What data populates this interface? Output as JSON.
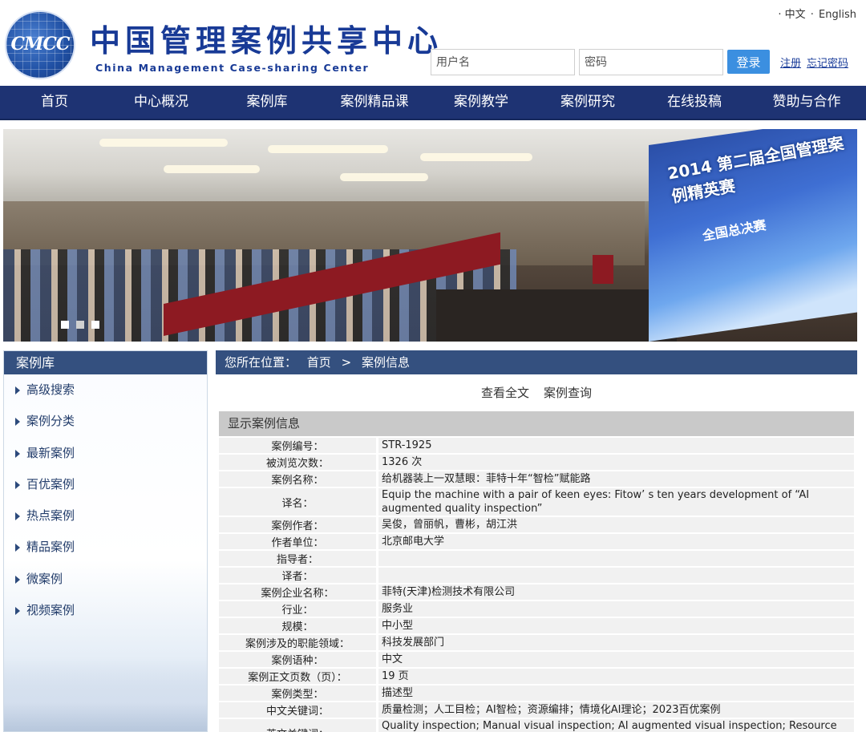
{
  "header": {
    "logo_abbr": "CMCC",
    "logo_cn": "中国管理案例共享中心",
    "logo_en": "China Management Case-sharing Center",
    "lang": {
      "cn": "· 中文",
      "sep": "·",
      "en": "English"
    },
    "login": {
      "username_placeholder": "用户名",
      "password_placeholder": "密码",
      "login_label": "登录",
      "register_label": "注册",
      "forgot_label": "忘记密码"
    }
  },
  "nav": {
    "items": [
      "首页",
      "中心概况",
      "案例库",
      "案例精品课",
      "案例教学",
      "案例研究",
      "在线投稿",
      "赞助与合作"
    ]
  },
  "banner": {
    "screen_title": "2014 第二届全国管理案例精英赛",
    "screen_sub": "全国总决赛",
    "slide_count": 3,
    "active_slide": 2
  },
  "sidebar": {
    "title": "案例库",
    "items": [
      "高级搜索",
      "案例分类",
      "最新案例",
      "百优案例",
      "热点案例",
      "精品案例",
      "微案例",
      "视频案例"
    ]
  },
  "main": {
    "breadcrumb": {
      "label": "您所在位置：",
      "home": "首页",
      "sep": ">",
      "current": "案例信息"
    },
    "tabs": [
      "查看全文",
      "案例查询"
    ],
    "panel_title": "显示案例信息",
    "rows": [
      {
        "k": "案例编号：",
        "v": "STR-1925"
      },
      {
        "k": "被浏览次数：",
        "v": "1326 次"
      },
      {
        "k": "案例名称：",
        "v": "给机器装上一双慧眼：菲特十年“智检”赋能路"
      },
      {
        "k": "译名：",
        "v": "Equip the machine with a pair of keen eyes: Fitow’ s ten years development of “AI augmented quality inspection”"
      },
      {
        "k": "案例作者：",
        "v": "吴俊，曾丽帆，曹彬，胡江洪"
      },
      {
        "k": "作者单位：",
        "v": "北京邮电大学"
      },
      {
        "k": "指导者：",
        "v": ""
      },
      {
        "k": "译者：",
        "v": ""
      },
      {
        "k": "案例企业名称：",
        "v": "菲特(天津)检测技术有限公司"
      },
      {
        "k": "行业：",
        "v": "服务业"
      },
      {
        "k": "规模：",
        "v": "中小型"
      },
      {
        "k": "案例涉及的职能领域：",
        "v": "科技发展部门"
      },
      {
        "k": "案例语种：",
        "v": "中文"
      },
      {
        "k": "案例正文页数（页）：",
        "v": "19 页"
      },
      {
        "k": "案例类型：",
        "v": "描述型"
      },
      {
        "k": "中文关键词：",
        "v": "质量检测；人工目检；AI智检；资源编排；情境化AI理论；2023百优案例"
      },
      {
        "k": "英文关键词：",
        "v": "Quality inspection; Manual visual inspection; AI augmented visual inspection; Resource orchestration; Theory of situated AI"
      }
    ]
  }
}
